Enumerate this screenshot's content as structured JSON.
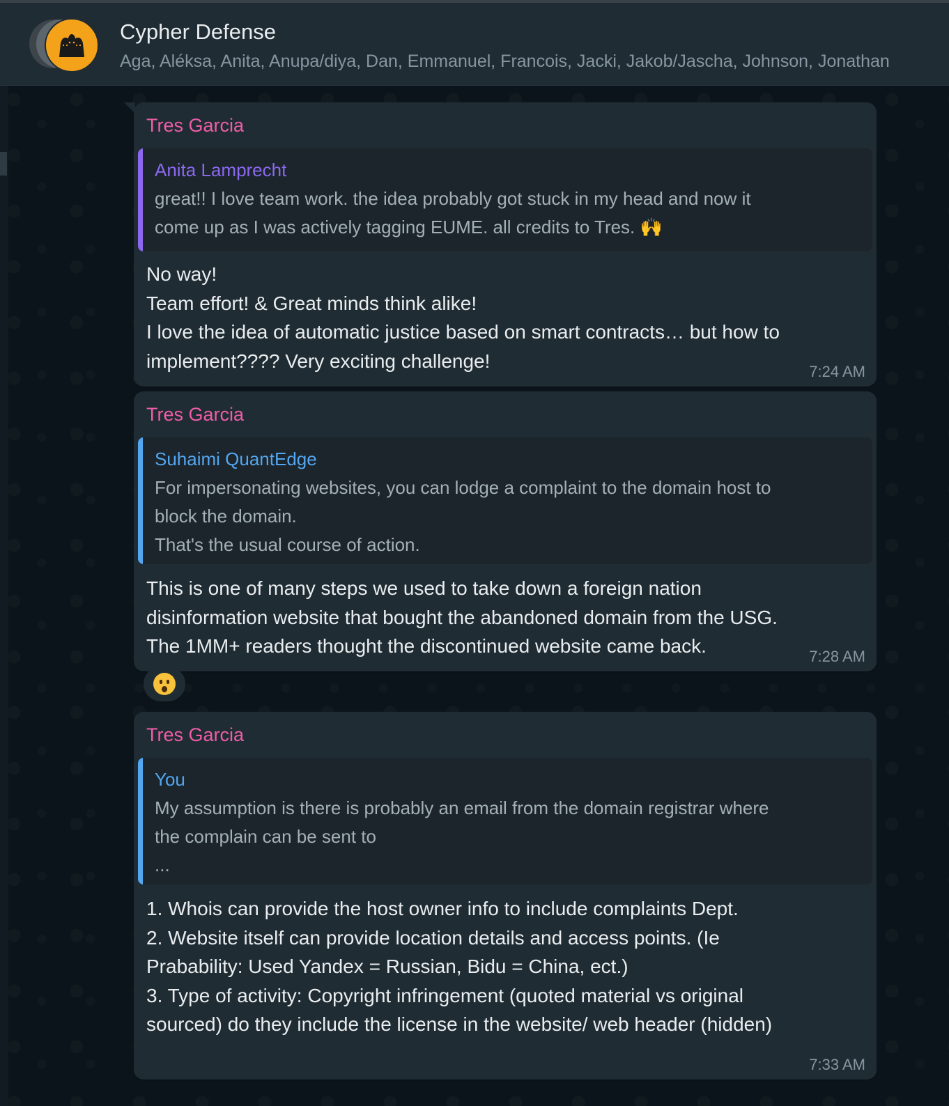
{
  "chat": {
    "title": "Cypher Defense",
    "members": "Aga, Aléksa, Anita, Anupa/diya, Dan, Emmanuel, Francois, Jacki, Jakob/Jascha, Johnson, Jonathan"
  },
  "colors": {
    "sender": "#ef5da8",
    "quote_anita": "#8c68f0",
    "quote_suhaimi": "#53a6f0",
    "quote_you": "#53a6f0",
    "avatar_bg": "#f5a21b"
  },
  "messages": [
    {
      "sender": "Tres Garcia",
      "quote": {
        "name": "Anita Lamprecht",
        "lines": [
          "great!! I love team work. the idea probably got stuck in my head and now it",
          "come up as I was actively tagging EUME. all credits to Tres. 🙌"
        ]
      },
      "lines": [
        "No way!",
        "Team effort! & Great minds think alike!",
        "I love the idea of automatic justice based on smart contracts… but how to",
        "implement???? Very exciting challenge!"
      ],
      "time": "7:24 AM"
    },
    {
      "sender": "Tres Garcia",
      "quote": {
        "name": "Suhaimi QuantEdge",
        "lines": [
          "For impersonating websites, you can lodge a complaint to the domain host to",
          "block the domain.",
          "That's the usual course of action."
        ]
      },
      "lines": [
        "This is one of many steps we used to take down a foreign nation",
        "disinformation website that bought the abandoned domain from the USG.",
        "The 1MM+ readers thought the discontinued website came back."
      ],
      "time": "7:28 AM",
      "reaction": "😮"
    },
    {
      "sender": "Tres Garcia",
      "quote": {
        "name": "You",
        "lines": [
          "My assumption is there is probably an email from the domain registrar where",
          "the complain can be sent to",
          "..."
        ]
      },
      "lines": [
        "1. Whois can provide the host owner info to include complaints Dept.",
        "2. Website itself can provide location details and access points. (Ie",
        "Prabability: Used Yandex = Russian, Bidu = China, ect.)",
        "3. Type of activity: Copyright infringement (quoted material vs original",
        "sourced) do they include the license in the website/ web header (hidden)"
      ],
      "time": "7:33 AM"
    }
  ]
}
